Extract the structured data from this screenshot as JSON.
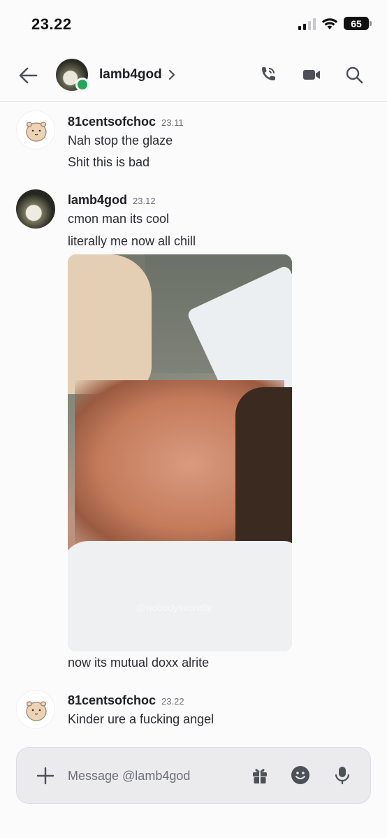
{
  "status_bar": {
    "time": "23.22",
    "battery": "65"
  },
  "header": {
    "name": "lamb4god"
  },
  "messages": [
    {
      "author": "81centsofchoc",
      "time": "23.11",
      "lines": [
        "Nah stop the glaze",
        "Shit this is bad"
      ]
    },
    {
      "author": "lamb4god",
      "time": "23.12",
      "lines": [
        "cmon man its cool",
        "literally me now all chill"
      ],
      "after_image": "now its mutual doxx alrite",
      "watermark": "@nobodysecretly"
    },
    {
      "author": "81centsofchoc",
      "time": "23.22",
      "lines": [
        "Kinder ure a fucking angel"
      ]
    }
  ],
  "composer": {
    "placeholder": "Message @lamb4god"
  },
  "colors": {
    "online": "#23a55a",
    "background": "#fbfbfc",
    "composer_bg": "#ebebee"
  }
}
